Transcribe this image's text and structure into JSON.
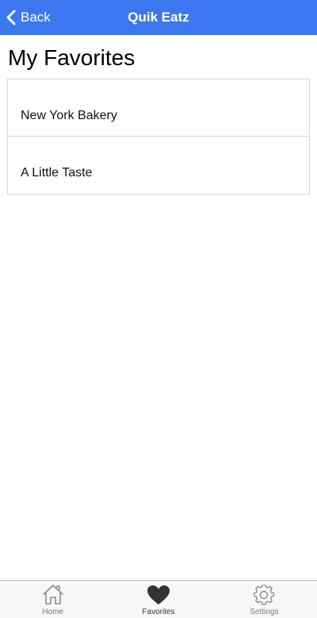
{
  "header": {
    "back_label": "Back",
    "title": "Quik Eatz",
    "back_icon": "chevron-left-icon"
  },
  "page": {
    "title": "My Favorites"
  },
  "favorites": [
    {
      "label": "New York Bakery"
    },
    {
      "label": "A Little Taste"
    }
  ],
  "tabbar": {
    "active": "Favorites",
    "tabs": [
      {
        "label": "Home",
        "icon": "home-icon"
      },
      {
        "label": "Favorites",
        "icon": "heart-icon"
      },
      {
        "label": "Settings",
        "icon": "gear-icon"
      }
    ]
  },
  "colors": {
    "header_bg": "#3b78f0",
    "active_icon": "#333333",
    "inactive_icon": "#8a8a8a"
  }
}
